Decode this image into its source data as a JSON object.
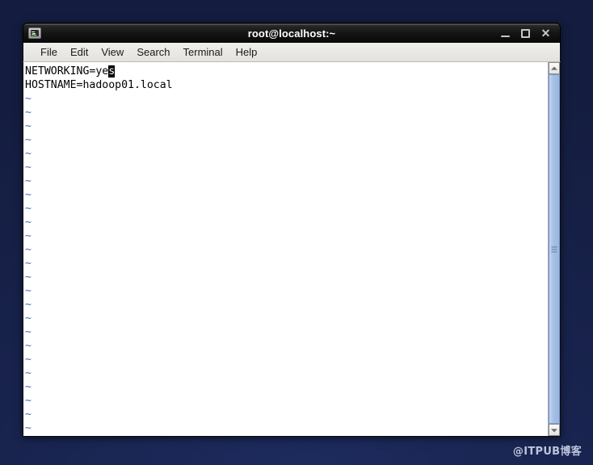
{
  "window": {
    "title": "root@localhost:~",
    "icon": "terminal-icon",
    "controls": {
      "minimize": "—",
      "maximize": "□",
      "close": "✕"
    }
  },
  "menubar": {
    "items": [
      {
        "label": "File"
      },
      {
        "label": "Edit"
      },
      {
        "label": "View"
      },
      {
        "label": "Search"
      },
      {
        "label": "Terminal"
      },
      {
        "label": "Help"
      }
    ]
  },
  "terminal": {
    "lines": [
      {
        "type": "text",
        "before": "NETWORKING=ye",
        "cursor": "s",
        "after": ""
      },
      {
        "type": "text",
        "before": "HOSTNAME=hadoop01.local",
        "cursor": "",
        "after": ""
      }
    ],
    "empty_marker": "~",
    "empty_line_count": 26,
    "colors": {
      "background": "#ffffff",
      "foreground": "#000000",
      "tilde": "#4b6ebd",
      "cursor_bg": "#000000",
      "cursor_fg": "#ffffff"
    }
  },
  "scrollbar": {
    "up_arrow": "scroll-up-arrow",
    "down_arrow": "scroll-down-arrow",
    "thumb_position": "full",
    "colors": {
      "trough": "#cdd8ec",
      "thumb": "#9ab6e2"
    }
  },
  "watermark": {
    "text": "@ITPUB博客"
  },
  "desktop": {
    "background": "#17224b"
  }
}
